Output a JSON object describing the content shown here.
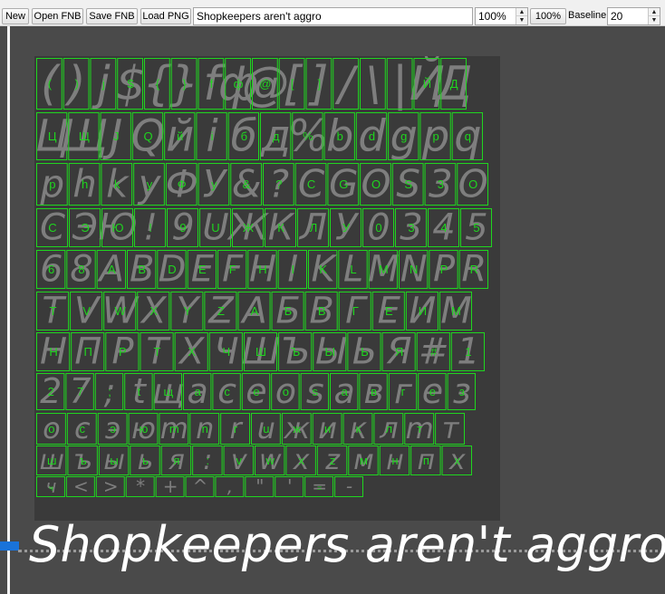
{
  "toolbar": {
    "new_label": "New",
    "open_label": "Open FNB",
    "save_label": "Save FNB",
    "load_png_label": "Load PNG",
    "sample_text": "Shopkeepers aren't aggro",
    "zoom_value": "100%",
    "reset_zoom_label": "100%",
    "baseline_label": "Baseline:",
    "baseline_value": "20"
  },
  "preview": {
    "text": "Shopkeepers aren't aggro"
  },
  "glyph_rows": [
    {
      "chars": "()j${}fф@[]/\\|ЙД",
      "labels": [
        "(",
        ")",
        "j",
        "$",
        "{",
        "}",
        "f",
        "ф",
        "@",
        "[",
        "]",
        "",
        "",
        "",
        "Й",
        "Д"
      ]
    },
    {
      "chars": "ЦЩJQйiбд%bdgpq",
      "labels": [
        "Ц",
        "Щ",
        "J",
        "Q",
        "й",
        "i",
        "б",
        "д",
        "%",
        "b",
        "d",
        "g",
        "p",
        "q"
      ]
    },
    {
      "chars": "phkyФУ&?CGOS3O",
      "labels": [
        "p",
        "h",
        "k",
        "y",
        "Ф",
        "у",
        "&",
        "?",
        "C",
        "G",
        "O",
        "S",
        "3",
        "O"
      ]
    },
    {
      "chars": "СЭЮ!9UЖКЛУ0345",
      "labels": [
        "С",
        "Э",
        "Ю",
        "!",
        "9",
        "U",
        "Ж",
        "К",
        "Л",
        "У",
        "0",
        "3",
        "4",
        "5"
      ]
    },
    {
      "chars": "68ABDEFHIKLMNPR",
      "labels": [
        "6",
        "8",
        "A",
        "B",
        "D",
        "E",
        "F",
        "H",
        "I",
        "K",
        "L",
        "M",
        "N",
        "P",
        "R"
      ]
    },
    {
      "chars": "TVWXYZАБВГЕИМ",
      "labels": [
        "T",
        "V",
        "W",
        "X",
        "Y",
        "Z",
        "А",
        "Б",
        "В",
        "Г",
        "Е",
        "И",
        "М"
      ]
    },
    {
      "chars": "НПРТХЧШЪЫЬЯ#1",
      "labels": [
        "Н",
        "П",
        "Р",
        "Т",
        "Х",
        "Ч",
        "Ш",
        "Ъ",
        "Ы",
        "Ь",
        "Я",
        "#",
        "1"
      ]
    },
    {
      "chars": "27;tщaceosaвгез",
      "labels": [
        "2",
        "7",
        ";",
        "t",
        "щ",
        "a",
        "c",
        "e",
        "o",
        "s",
        "а",
        "в",
        "г",
        "е",
        "з"
      ]
    },
    {
      "chars": "осэюmnruжиклmт",
      "labels": [
        "о",
        "с",
        "э",
        "ю",
        "m",
        "n",
        "r",
        "u",
        "ж",
        "и",
        "к",
        "л",
        "т",
        ""
      ]
    },
    {
      "chars": "шъыья:vwxzмнпх",
      "labels": [
        "ш",
        "ъ",
        "ы",
        "ь",
        "я",
        ":",
        "v",
        "w",
        "x",
        "z",
        "м",
        "н",
        "п",
        "х"
      ]
    },
    {
      "chars": "ч<>*+^,\"'=-",
      "labels": [
        "ч",
        "",
        "",
        "",
        "",
        "",
        "",
        "",
        "",
        "=",
        ""
      ]
    }
  ],
  "colors": {
    "background": "#4a4a4a",
    "atlas_background": "#3a3a3a",
    "glyph_fill": "#7e7e7e",
    "glyph_box": "#1fd61f",
    "preview_text": "#ffffff",
    "marker": "#1a73d9"
  }
}
